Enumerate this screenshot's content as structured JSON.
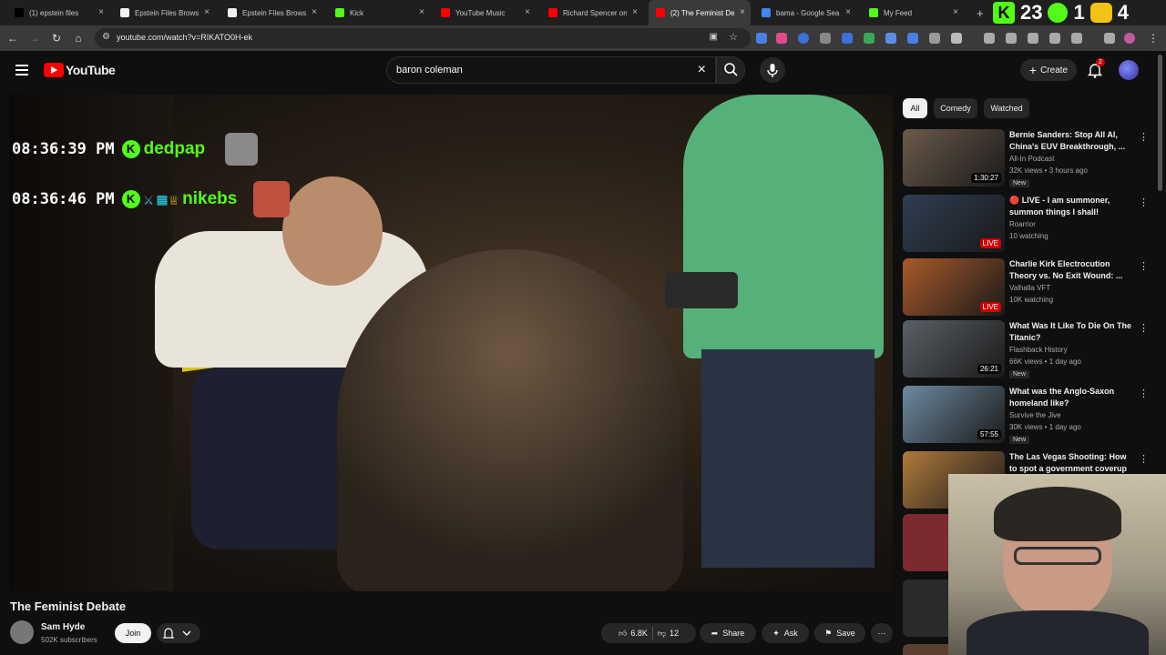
{
  "browser": {
    "tabs": [
      {
        "label": "(1) epstein files",
        "color": "#000000"
      },
      {
        "label": "Epstein Files Browse",
        "color": "#f1f1f1"
      },
      {
        "label": "Epstein Files Browse",
        "color": "#f1f1f1"
      },
      {
        "label": "Kick",
        "color": "#53fc18"
      },
      {
        "label": "YouTube Music",
        "color": "#ff0000"
      },
      {
        "label": "Richard Spencer on",
        "color": "#ff0000"
      },
      {
        "label": "(2) The Feminist De",
        "color": "#ff0000"
      },
      {
        "label": "bama - Google Sea",
        "color": "#4285f4"
      },
      {
        "label": "My Feed",
        "color": "#53fc18"
      }
    ],
    "url": "youtube.com/watch?v=RIKATO0H-ek",
    "overlay_counts": [
      "23",
      "1",
      "4"
    ]
  },
  "youtube": {
    "logo_text": "YouTube",
    "search_value": "baron coleman",
    "create_label": "Create",
    "notification_count": "2"
  },
  "video": {
    "title": "The Feminist Debate",
    "channel": "Sam Hyde",
    "subscribers": "502K subscribers",
    "join_label": "Join",
    "likes": "6.8K",
    "dislikes": "12",
    "share_label": "Share",
    "ask_label": "Ask",
    "save_label": "Save",
    "chat": [
      {
        "time": "08:36:39 PM",
        "user": "dedpap"
      },
      {
        "time": "08:36:46 PM",
        "user": "nikebs"
      }
    ]
  },
  "sidebar": {
    "chips": [
      "All",
      "Comedy",
      "Watched"
    ],
    "recs": [
      {
        "title": "Bernie Sanders: Stop All AI, China's EUV Breakthrough, ...",
        "channel": "All-In Podcast",
        "meta": "32K views • 3 hours ago",
        "duration": "1:30:27",
        "badge": "New",
        "thumb": "#6b5a4a",
        "live": false
      },
      {
        "title": "🔴 LIVE - I am summoner, summon things I shall!",
        "channel": "Roarrior",
        "meta": "10 watching",
        "duration": "LIVE",
        "badge": "",
        "thumb": "#2f3e52",
        "live": true
      },
      {
        "title": "Charlie Kirk Electrocution Theory vs. No Exit Wound: ...",
        "channel": "Valhalla VFT",
        "meta": "10K watching",
        "duration": "LIVE",
        "badge": "",
        "thumb": "#a85a2a",
        "live": true
      },
      {
        "title": "What Was It Like To Die On The Titanic?",
        "channel": "Flashback History",
        "meta": "66K views • 1 day ago",
        "duration": "26:21",
        "badge": "New",
        "thumb": "#5b6066",
        "live": false
      },
      {
        "title": "What was the Anglo-Saxon homeland like?",
        "channel": "Survive the Jive",
        "meta": "30K views • 1 day ago",
        "duration": "57:55",
        "badge": "New",
        "thumb": "#6d8aa0",
        "live": false
      },
      {
        "title": "The Las Vegas Shooting: How to spot a government coverup ...",
        "channel": "",
        "meta": "",
        "duration": "",
        "badge": "",
        "thumb": "#b07a3a",
        "live": false
      }
    ]
  }
}
